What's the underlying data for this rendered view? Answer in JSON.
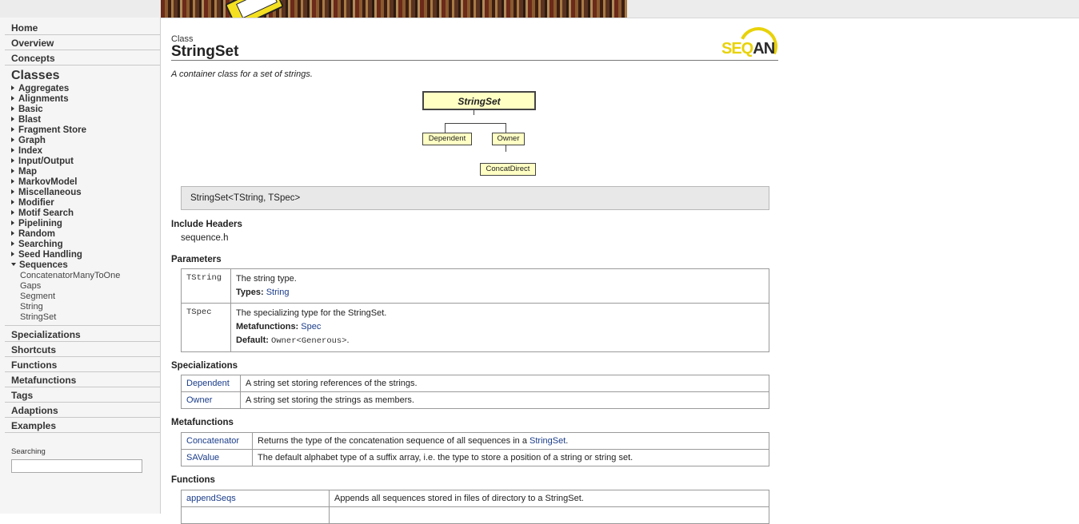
{
  "sidebar": {
    "top_items": [
      "Home",
      "Overview",
      "Concepts"
    ],
    "classes_heading": "Classes",
    "categories": [
      "Aggregates",
      "Alignments",
      "Basic",
      "Blast",
      "Fragment Store",
      "Graph",
      "Index",
      "Input/Output",
      "Map",
      "MarkovModel",
      "Miscellaneous",
      "Modifier",
      "Motif Search",
      "Pipelining",
      "Random",
      "Searching",
      "Seed Handling"
    ],
    "expanded_category": "Sequences",
    "sequences_items": [
      "ConcatenatorManyToOne",
      "Gaps",
      "Segment",
      "String",
      "StringSet"
    ],
    "bottom_items": [
      "Specializations",
      "Shortcuts",
      "Functions",
      "Metafunctions",
      "Tags",
      "Adaptions",
      "Examples"
    ],
    "search": {
      "label": "Searching",
      "value": "",
      "placeholder": ""
    }
  },
  "page": {
    "class_label": "Class",
    "title": "StringSet",
    "summary": "A container class for a set of strings.",
    "logo": {
      "text_a": "SEQ",
      "text_b": "AN"
    },
    "diagram": {
      "main": "StringSet",
      "children": [
        "Dependent",
        "Owner"
      ],
      "grandchild": "ConcatDirect"
    },
    "signature": "StringSet<TString, TSpec>",
    "include_headers": {
      "heading": "Include Headers",
      "value": "sequence.h"
    },
    "parameters": {
      "heading": "Parameters",
      "rows": [
        {
          "name": "TString",
          "desc": "The string type.",
          "types_label": "Types:",
          "types_value": "String"
        },
        {
          "name": "TSpec",
          "desc": "The specializing type for the StringSet.",
          "meta_label": "Metafunctions:",
          "meta_value": "Spec",
          "default_label": "Default:",
          "default_value": "Owner<Generous>",
          "default_suffix": "."
        }
      ]
    },
    "specializations": {
      "heading": "Specializations",
      "rows": [
        {
          "name": "Dependent",
          "desc": "A string set storing references of the strings."
        },
        {
          "name": "Owner",
          "desc": "A string set storing the strings as members."
        }
      ]
    },
    "metafunctions": {
      "heading": "Metafunctions",
      "rows": [
        {
          "name": "Concatenator",
          "desc": "Returns the type of the concatenation sequence of all sequences in a ",
          "link": "StringSet",
          "suffix": "."
        },
        {
          "name": "SAValue",
          "desc": "The default alphabet type of a suffix array, i.e. the type to store a position of a string or string set."
        }
      ]
    },
    "functions": {
      "heading": "Functions",
      "rows": [
        {
          "name": "appendSeqs",
          "desc": "Appends all sequences stored in files of directory to a StringSet."
        }
      ]
    }
  }
}
